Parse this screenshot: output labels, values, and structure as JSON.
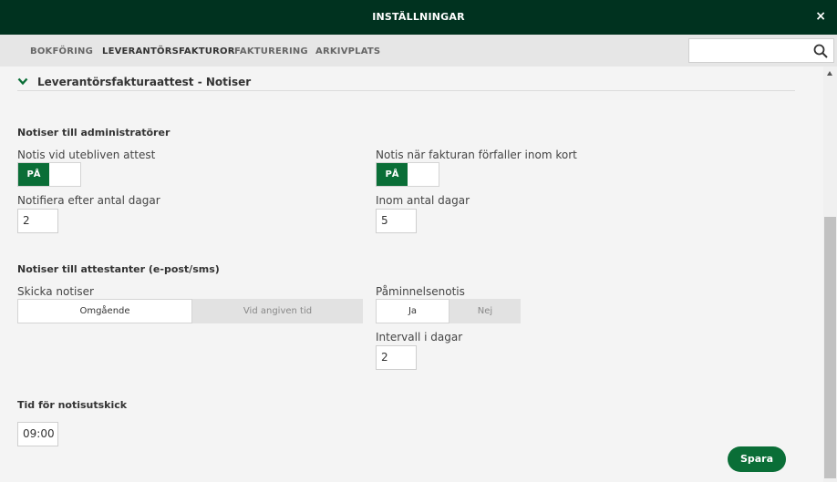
{
  "header": {
    "title": "INSTÄLLNINGAR",
    "close_label": "×"
  },
  "tabs": [
    {
      "label": "BOKFÖRING"
    },
    {
      "label": "LEVERANTÖRSFAKTUROR"
    },
    {
      "label": "FAKTURERING"
    },
    {
      "label": "ARKIVPLATS"
    }
  ],
  "search": {
    "value": "",
    "placeholder": ""
  },
  "section": {
    "title": "Leverantörsfakturaattest - Notiser"
  },
  "admin": {
    "heading": "Notiser till administratörer",
    "missing_attest_label": "Notis vid utebliven attest",
    "missing_attest_toggle": "PÅ",
    "notify_after_label": "Notifiera efter antal dagar",
    "notify_after_value": "2",
    "due_soon_label": "Notis när fakturan förfaller inom kort",
    "due_soon_toggle": "PÅ",
    "within_days_label": "Inom antal dagar",
    "within_days_value": "5"
  },
  "attesters": {
    "heading": "Notiser till attestanter (e-post/sms)",
    "send_label": "Skicka notiser",
    "send_options": [
      "Omgående",
      "Vid angiven tid"
    ],
    "reminder_label": "Påminnelsenotis",
    "reminder_options": [
      "Ja",
      "Nej"
    ],
    "interval_label": "Intervall i dagar",
    "interval_value": "2"
  },
  "send_time": {
    "heading": "Tid för notisutskick",
    "value": "09:00"
  },
  "actions": {
    "save_label": "Spara"
  },
  "colors": {
    "header_bg": "#00321f",
    "accent_green": "#0a6e37"
  }
}
